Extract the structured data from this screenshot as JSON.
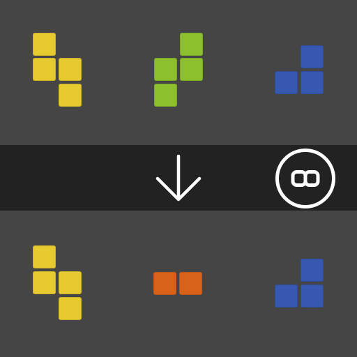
{
  "colors": {
    "background": "#454545",
    "band": "#222222",
    "yellow": "#E7C930",
    "green": "#8CC02E",
    "blue": "#3658B0",
    "orange": "#D8621A",
    "icon": "#FFFFFF"
  },
  "pieces_before": [
    {
      "name": "yellow-s-piece",
      "color": "yellow"
    },
    {
      "name": "green-s-piece",
      "color": "green"
    },
    {
      "name": "blue-l-piece",
      "color": "blue"
    }
  ],
  "pieces_after": [
    {
      "name": "yellow-s-piece",
      "color": "yellow"
    },
    {
      "name": "orange-domino-piece",
      "color": "orange"
    },
    {
      "name": "blue-l-piece",
      "color": "blue"
    }
  ],
  "controls": {
    "transform_icon": "arrow-down-icon",
    "action_button_icon": "infinity-icon"
  }
}
